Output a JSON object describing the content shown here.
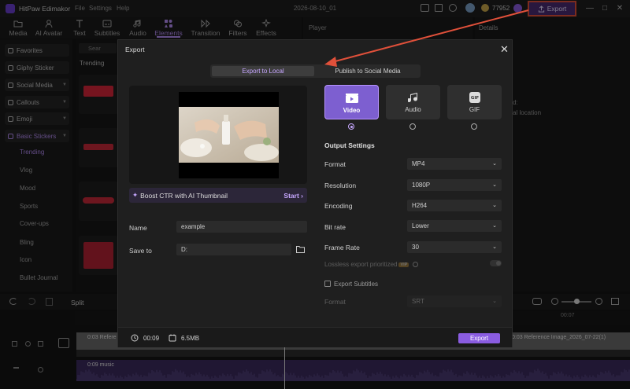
{
  "app": {
    "name": "HitPaw Edimakor",
    "menu": [
      "File",
      "Settings",
      "Help"
    ],
    "doc_title": "2026-08-10_01",
    "credits": "77952",
    "export_label": "Export"
  },
  "toolbar": {
    "tools": [
      {
        "label": "Media",
        "icon": "folder-icon"
      },
      {
        "label": "AI Avatar",
        "icon": "avatar-icon"
      },
      {
        "label": "Text",
        "icon": "text-icon"
      },
      {
        "label": "Subtitles",
        "icon": "subtitles-icon"
      },
      {
        "label": "Audio",
        "icon": "music-icon"
      },
      {
        "label": "Elements",
        "icon": "elements-icon"
      },
      {
        "label": "Transition",
        "icon": "transition-icon"
      },
      {
        "label": "Filters",
        "icon": "filters-icon"
      },
      {
        "label": "Effects",
        "icon": "effects-icon"
      }
    ],
    "player": "Player",
    "details": "Details"
  },
  "sidebar": {
    "items": [
      "Favorites",
      "Giphy Sticker",
      "Social Media",
      "Callouts",
      "Emoji",
      "Basic Stickers"
    ],
    "subitems": [
      "Trending",
      "Vlog",
      "Mood",
      "Sports",
      "Cover-ups",
      "Bling",
      "Icon",
      "Bullet Journal"
    ],
    "trending_header": "Trending",
    "search_placeholder": "Sear"
  },
  "details_panel": {
    "line1": "d:",
    "line2": "al location"
  },
  "timeline": {
    "split_label": "Split",
    "ruler_mark": "00:07",
    "video_label_left": "0:03 Refere",
    "video_label_right": "0:03 Reference Image_2026_07-22(1)",
    "audio_label": "0:09 music"
  },
  "dialog": {
    "title": "Export",
    "tabs": [
      "Export to Local",
      "Publish to Social Media"
    ],
    "boost_text": "Boost CTR with AI Thumbnail",
    "boost_start": "Start",
    "name_label": "Name",
    "name_value": "example",
    "saveto_label": "Save to",
    "saveto_value": "D:",
    "formats": [
      "Video",
      "Audio",
      "GIF"
    ],
    "output_title": "Output Settings",
    "options": [
      {
        "label": "Format",
        "value": "MP4"
      },
      {
        "label": "Resolution",
        "value": "1080P"
      },
      {
        "label": "Encoding",
        "value": "H264"
      },
      {
        "label": "Bit rate",
        "value": "Lower"
      },
      {
        "label": "Frame Rate",
        "value": "30"
      }
    ],
    "lossless_label": "Lossless export prioritized",
    "vip_badge": "VIP",
    "subtitles_label": "Export Subtitles",
    "sub_format_label": "Format",
    "sub_format_value": "SRT",
    "duration": "00:09",
    "size": "6.5MB",
    "export_button": "Export"
  },
  "colors": {
    "accent": "#8a5ce0",
    "annotation": "#e0503a"
  }
}
